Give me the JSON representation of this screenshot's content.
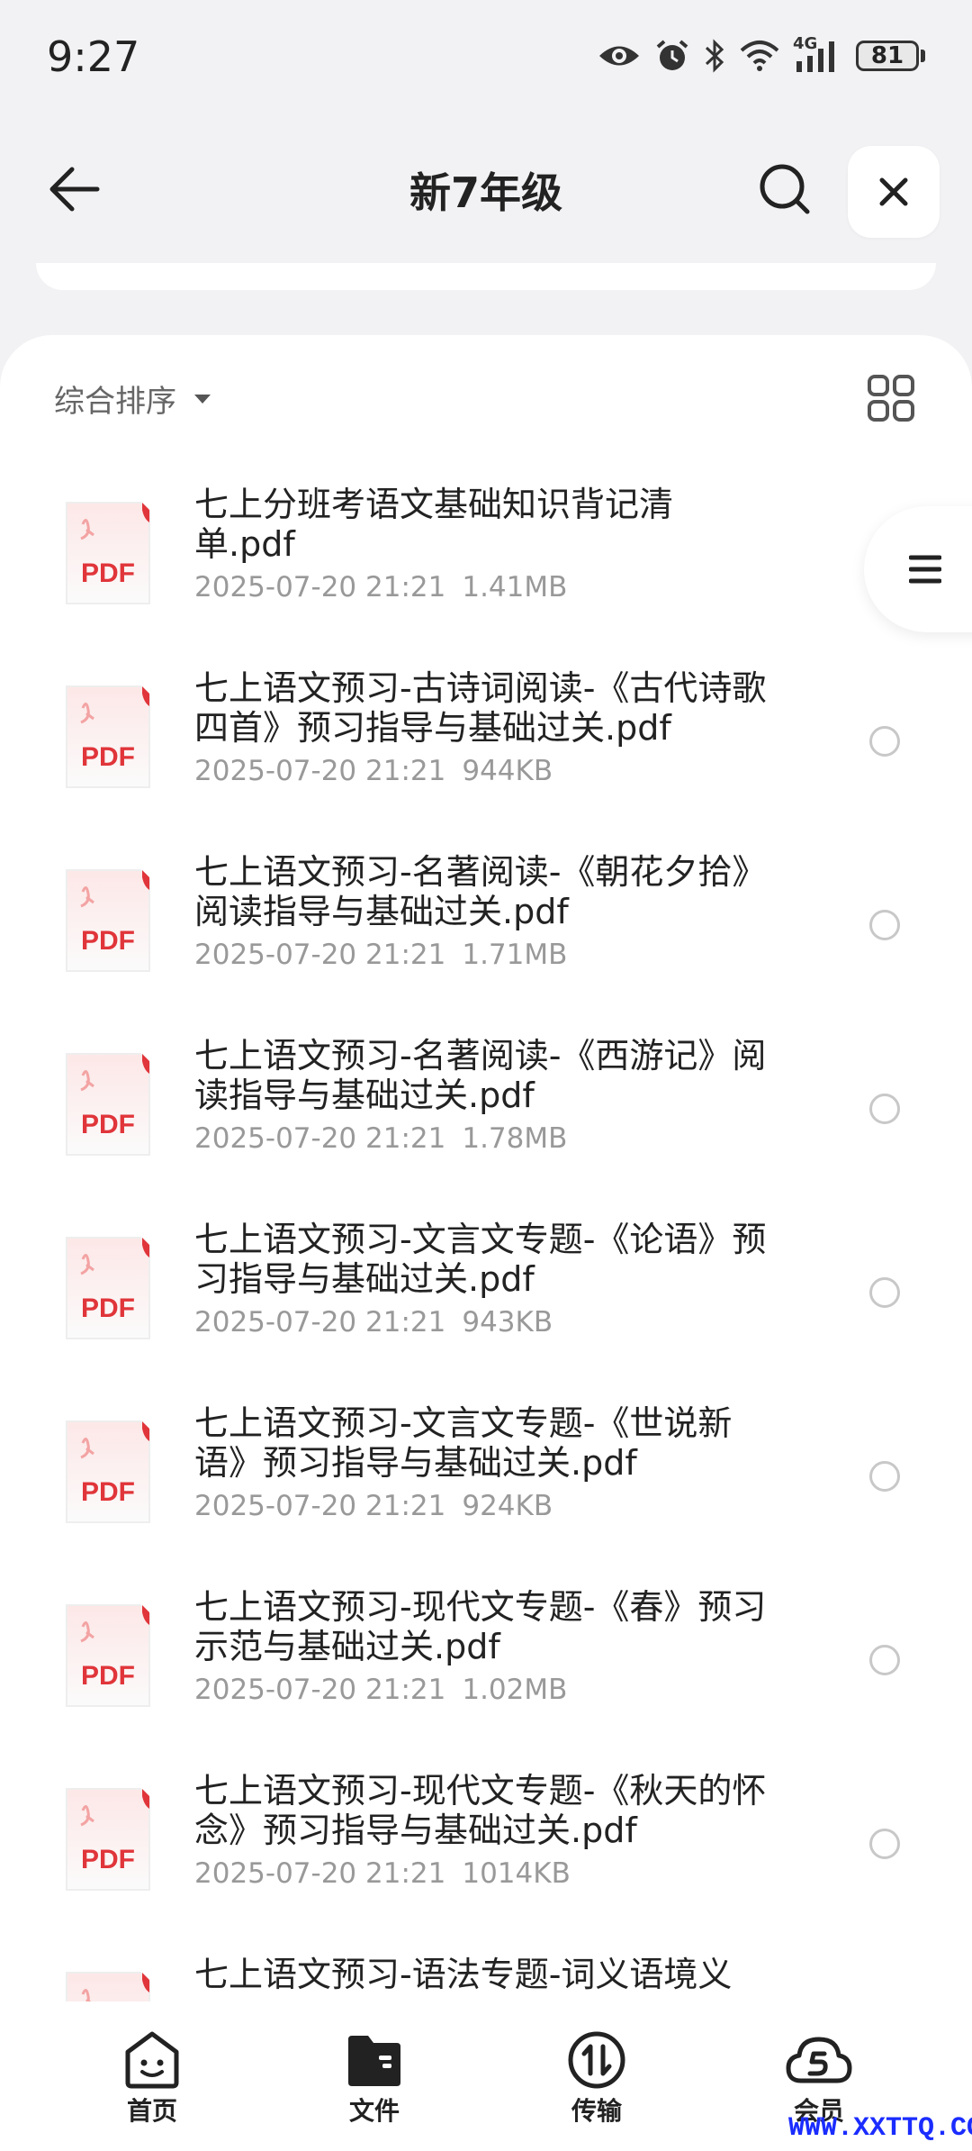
{
  "status_bar": {
    "time": "9:27",
    "network": "4G",
    "battery": "81"
  },
  "header": {
    "title": "新7年级"
  },
  "toolbar": {
    "sort_label": "综合排序"
  },
  "pdf_icon_text": "PDF",
  "files": [
    {
      "name": "七上分班考语文基础知识背记清单.pdf",
      "date": "2025-07-20 21:21",
      "size": "1.41MB"
    },
    {
      "name": "七上语文预习-古诗词阅读-《古代诗歌四首》预习指导与基础过关.pdf",
      "date": "2025-07-20 21:21",
      "size": "944KB"
    },
    {
      "name": "七上语文预习-名著阅读-《朝花夕拾》阅读指导与基础过关.pdf",
      "date": "2025-07-20 21:21",
      "size": "1.71MB"
    },
    {
      "name": "七上语文预习-名著阅读-《西游记》阅读指导与基础过关.pdf",
      "date": "2025-07-20 21:21",
      "size": "1.78MB"
    },
    {
      "name": "七上语文预习-文言文专题-《论语》预习指导与基础过关.pdf",
      "date": "2025-07-20 21:21",
      "size": "943KB"
    },
    {
      "name": "七上语文预习-文言文专题-《世说新语》预习指导与基础过关.pdf",
      "date": "2025-07-20 21:21",
      "size": "924KB"
    },
    {
      "name": "七上语文预习-现代文专题-《春》预习示范与基础过关.pdf",
      "date": "2025-07-20 21:21",
      "size": "1.02MB"
    },
    {
      "name": "七上语文预习-现代文专题-《秋天的怀念》预习指导与基础过关.pdf",
      "date": "2025-07-20 21:21",
      "size": "1014KB"
    },
    {
      "name": "七上语文预习-语法专题-词义语境义",
      "date": "",
      "size": ""
    }
  ],
  "bottom_nav": {
    "home": "首页",
    "files": "文件",
    "transfer": "传输",
    "member": "会员"
  },
  "watermark": "WWW.XXTTQ.COM",
  "colors": {
    "background": "#f2f2f4",
    "pdf_red": "#e0353a",
    "watermark": "#1a2cff"
  }
}
